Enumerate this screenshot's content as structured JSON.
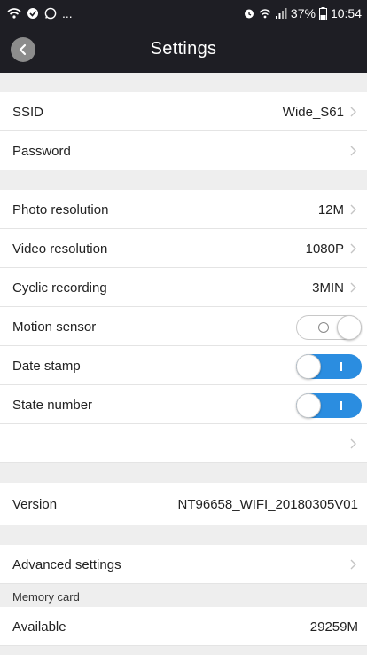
{
  "status_bar": {
    "left_icons": [
      "wifi-icon",
      "shield-icon",
      "whatsapp-icon",
      "more-icon"
    ],
    "more_text": "...",
    "battery": "37%",
    "time": "10:54"
  },
  "header": {
    "title": "Settings"
  },
  "wifi": {
    "ssid_label": "SSID",
    "ssid_value": "Wide_S61",
    "password_label": "Password"
  },
  "camera": {
    "photo_resolution_label": "Photo resolution",
    "photo_resolution_value": "12M",
    "video_resolution_label": "Video resolution",
    "video_resolution_value": "1080P",
    "cyclic_recording_label": "Cyclic recording",
    "cyclic_recording_value": "3MIN",
    "motion_sensor_label": "Motion sensor",
    "motion_sensor_on": false,
    "date_stamp_label": "Date stamp",
    "date_stamp_on": true,
    "state_number_label": "State number",
    "state_number_on": true
  },
  "version": {
    "label": "Version",
    "value": "NT96658_WIFI_20180305V01"
  },
  "advanced": {
    "label": "Advanced settings"
  },
  "memory": {
    "section_label": "Memory card",
    "available_label": "Available",
    "available_value": "29259M"
  },
  "colors": {
    "bar_bg": "#1e1e24",
    "accent": "#2b8de0",
    "page_bg": "#eeeeee"
  }
}
